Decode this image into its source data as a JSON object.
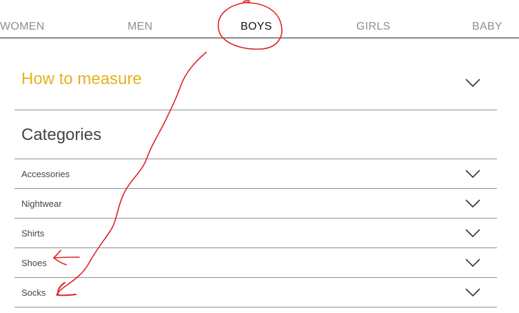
{
  "tabs": [
    {
      "label": "WOMEN",
      "active": false
    },
    {
      "label": "MEN",
      "active": false
    },
    {
      "label": "BOYS",
      "active": true
    },
    {
      "label": "GIRLS",
      "active": false
    },
    {
      "label": "BABY",
      "active": false
    }
  ],
  "measure": {
    "title": "How to measure",
    "icon": "chevron-down-icon"
  },
  "categories": {
    "heading": "Categories",
    "items": [
      {
        "label": "Accessories",
        "icon": "chevron-down-icon"
      },
      {
        "label": "Nightwear",
        "icon": "chevron-down-icon"
      },
      {
        "label": "Shirts",
        "icon": "chevron-down-icon"
      },
      {
        "label": "Shoes",
        "icon": "chevron-down-icon"
      },
      {
        "label": "Socks",
        "icon": "chevron-down-icon"
      }
    ]
  },
  "colors": {
    "accent": "#e6b21c",
    "annotation": "#e02020",
    "divider": "#8c8c8c",
    "tab_inactive": "#8f8f8f",
    "tab_active": "#111111"
  }
}
